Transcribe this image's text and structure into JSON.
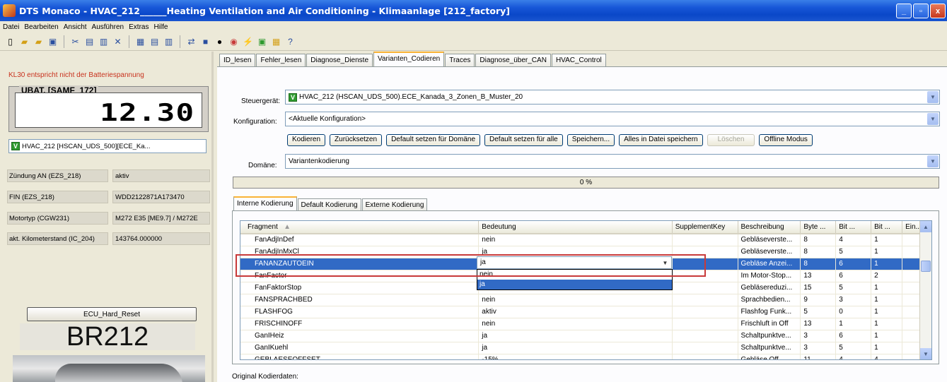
{
  "window": {
    "title": "DTS Monaco - HVAC_212______Heating Ventilation and Air Conditioning - Klimaanlage [212_factory]",
    "buttons": {
      "minimize": "_",
      "maximize": "▫",
      "close": "x"
    }
  },
  "menu": [
    "Datei",
    "Bearbeiten",
    "Ansicht",
    "Ausführen",
    "Extras",
    "Hilfe"
  ],
  "toolbar_icons": [
    "new-icon",
    "open-icon",
    "open-folder-icon",
    "save-icon",
    "cut-icon",
    "copy-icon",
    "paste-icon",
    "delete-icon",
    "view1-icon",
    "view2-icon",
    "view3-icon",
    "connect-icon",
    "record-icon",
    "globe-icon",
    "settings-icon",
    "plug-icon",
    "monitor-icon",
    "calendar-icon",
    "help-icon"
  ],
  "left": {
    "warning": "KL30 entspricht nicht der Batteriespannung",
    "ubat_label": "UBAT. [SAMF_172]",
    "ubat_value": "12.30",
    "ecu_badge": "V",
    "ecu_field": "HVAC_212 [HSCAN_UDS_500][ECE_Ka...",
    "info": [
      {
        "label": "Zündung AN (EZS_218)",
        "value": "aktiv"
      },
      {
        "label": "FIN  (EZS_218)",
        "value": "WDD2122871A173470"
      },
      {
        "label": "Motortyp (CGW231)",
        "value": "M272 E35 [ME9.7] / M272E"
      },
      {
        "label": "akt. Kilometerstand (IC_204)",
        "value": "143764.000000"
      }
    ],
    "reset_button": "ECU_Hard_Reset",
    "model": "BR212"
  },
  "main_tabs": [
    "ID_lesen",
    "Fehler_lesen",
    "Diagnose_Dienste",
    "Varianten_Codieren",
    "Traces",
    "Diagnose_über_CAN",
    "HVAC_Control"
  ],
  "active_tab": "Varianten_Codieren",
  "form": {
    "steuergeraet_label": "Steuergerät:",
    "steuergeraet_badge": "V",
    "steuergeraet_value": "HVAC_212 (HSCAN_UDS_500).ECE_Kanada_3_Zonen_B_Muster_20",
    "konfiguration_label": "Konfiguration:",
    "konfiguration_value": "<Aktuelle Konfiguration>",
    "domaene_label": "Domäne:",
    "domaene_value": "Variantenkodierung"
  },
  "buttons": [
    "Kodieren",
    "Zurücksetzen",
    "Default setzen für Domäne",
    "Default setzen für alle",
    "Speichern...",
    "Alles in Datei speichern",
    "Löschen",
    "Offline Modus"
  ],
  "progress": {
    "value": 0,
    "label": "0 %"
  },
  "sub_tabs": [
    "Interne Kodierung",
    "Default Kodierung",
    "Externe Kodierung"
  ],
  "table": {
    "columns": [
      "Fragment",
      "Bedeutung",
      "SupplementKey",
      "Beschreibung",
      "Byte ...",
      "Bit ...",
      "Bit ...",
      "Ein..."
    ],
    "sort_indicator": "▲",
    "rows": [
      [
        "FanAdjInDef",
        "nein",
        "",
        "Gebläseverste...",
        "8",
        "4",
        "1",
        ""
      ],
      [
        "FanAdjInMxCl",
        "ja",
        "",
        "Gebläseverste...",
        "8",
        "5",
        "1",
        ""
      ],
      [
        "FANANZAUTOEIN",
        "ja",
        "",
        "Gebläse Anzei...",
        "8",
        "6",
        "1",
        ""
      ],
      [
        "FanFactor",
        "nein",
        "",
        "Im Motor-Stop...",
        "13",
        "6",
        "2",
        ""
      ],
      [
        "FanFaktorStop",
        "",
        "",
        "Gebläsereduzi...",
        "15",
        "5",
        "1",
        ""
      ],
      [
        "FANSPRACHBED",
        "nein",
        "",
        "Sprachbedien...",
        "9",
        "3",
        "1",
        ""
      ],
      [
        "FLASHFOG",
        "aktiv",
        "",
        "Flashfog Funk...",
        "5",
        "0",
        "1",
        ""
      ],
      [
        "FRISCHINOFF",
        "nein",
        "",
        "Frischluft in Off",
        "13",
        "1",
        "1",
        ""
      ],
      [
        "GanIHeiz",
        "ja",
        "",
        "Schaltpunktve...",
        "3",
        "6",
        "1",
        ""
      ],
      [
        "GanIKuehl",
        "ja",
        "",
        "Schaltpunktve...",
        "3",
        "5",
        "1",
        ""
      ],
      [
        "GEBLAESEOFFSET",
        "-15%",
        "",
        "Gebläse Off...",
        "11",
        "4",
        "4",
        ""
      ]
    ],
    "selected_row": 2
  },
  "edit_cell": {
    "value": "ja",
    "options": [
      "nein",
      "ja"
    ],
    "highlighted": "ja"
  },
  "original_label": "Original Kodierdaten:"
}
